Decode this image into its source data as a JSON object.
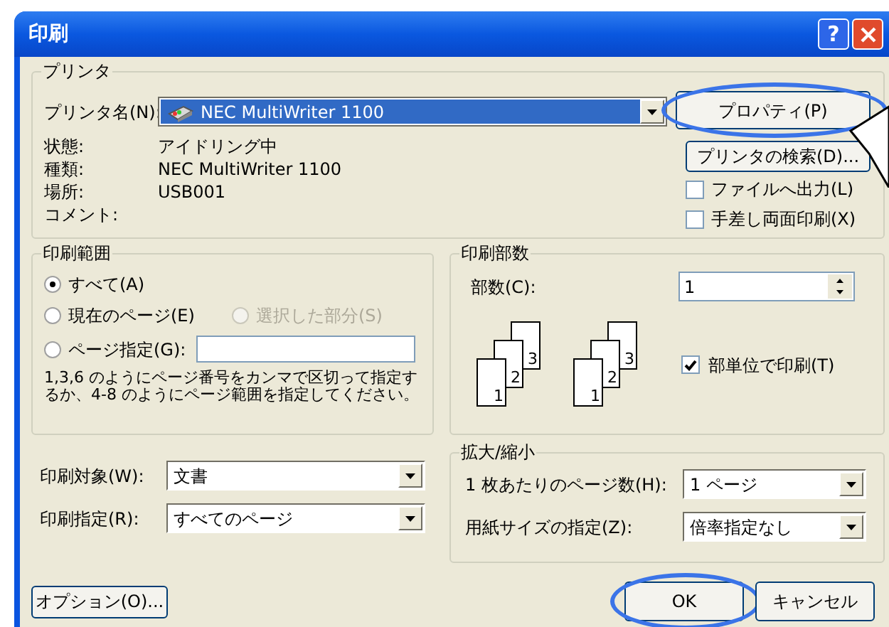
{
  "window": {
    "title": "印刷",
    "help": "?"
  },
  "printer": {
    "legend": "プリンタ",
    "name_label": "プリンタ名(N):",
    "name_value": "NEC MultiWriter 1100",
    "info": [
      {
        "label": "状態:",
        "value": "アイドリング中"
      },
      {
        "label": "種類:",
        "value": "NEC MultiWriter 1100"
      },
      {
        "label": "場所:",
        "value": "USB001"
      },
      {
        "label": "コメント:"
      }
    ],
    "buttons": [
      {
        "label": "プロパティ(P)",
        "circled": true
      },
      {
        "label": "プリンタの検索(D)...",
        "circled": false
      }
    ],
    "options": [
      {
        "label": "ファイルへ出力(L)",
        "checked": false
      },
      {
        "label": "手差し両面印刷(X)",
        "checked": false
      }
    ]
  },
  "range": {
    "legend": "印刷範囲",
    "options": [
      {
        "label": "すべて(A)",
        "selected": true,
        "disabled": false
      },
      {
        "label": "現在のページ(E)",
        "selected": false,
        "disabled": false
      },
      {
        "label": "選択した部分(S)",
        "selected": false,
        "disabled": true
      },
      {
        "label": "ページ指定(G):",
        "selected": false,
        "disabled": false
      }
    ],
    "hint": "1,3,6 のようにページ番号をカンマで区切って指定するか、4-8 のようにページ範囲を指定してください。"
  },
  "copies": {
    "legend": "印刷部数",
    "count_label": "部数(C):",
    "count_value": "1",
    "stacks": [
      {
        "pages": [
          "1",
          "2",
          "3"
        ]
      },
      {
        "pages": [
          "1",
          "2",
          "3"
        ]
      }
    ],
    "collate_label": "部単位で印刷(T)",
    "collate_checked": true
  },
  "print_fields": [
    {
      "label": "印刷対象(W):",
      "value": "文書"
    },
    {
      "label": "印刷指定(R):",
      "value": "すべてのページ"
    }
  ],
  "zoom": {
    "legend": "拡大/縮小",
    "rows": [
      {
        "label": "1 枚あたりのページ数(H):",
        "value": "1 ページ"
      },
      {
        "label": "用紙サイズの指定(Z):",
        "value": "倍率指定なし"
      }
    ]
  },
  "footer": [
    {
      "label": "オプション(O)...",
      "circled": false
    },
    {
      "label": "OK",
      "circled": true
    },
    {
      "label": "キャンセル",
      "circled": false
    }
  ]
}
